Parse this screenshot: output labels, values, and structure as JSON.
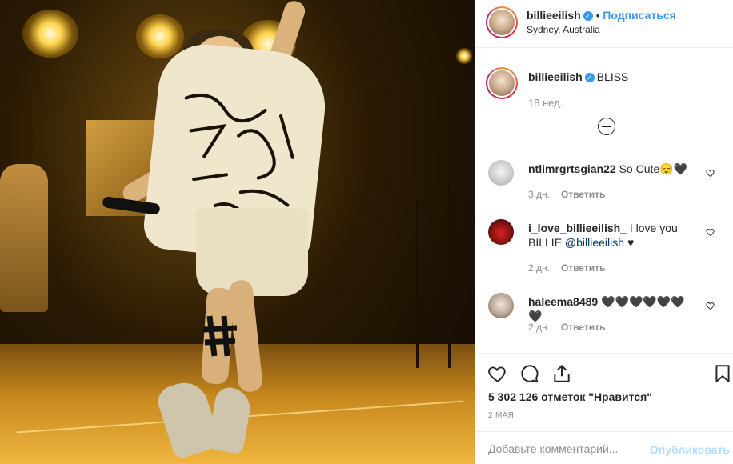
{
  "post": {
    "author": "billieeilish",
    "follow_label": "Подписаться",
    "separator": "•",
    "location": "Sydney, Australia",
    "verified_glyph": "✓"
  },
  "caption": {
    "author": "billieeilish",
    "text": "BLISS",
    "time": "18 нед."
  },
  "comments": [
    {
      "username": "ntlimrgrtsgian22",
      "text": "So Cute😌🖤",
      "time": "3 дн.",
      "reply": "Ответить"
    },
    {
      "username": "i_love_billieeilish_",
      "text_before": "I love you BILLIE ",
      "mention": "@billieeilish",
      "text_after": " ♥",
      "time": "2 дн.",
      "reply": "Ответить"
    },
    {
      "username": "haleema8489",
      "text": "🖤🖤🖤🖤🖤🖤🖤",
      "time": "2 дн.",
      "reply": "Ответить"
    }
  ],
  "actions": {
    "likes": "5 302 126 отметок \"Нравится\"",
    "date": "2 МАЯ",
    "comment_placeholder": "Добавьте комментарий...",
    "publish_label": "Опубликовать"
  },
  "colors": {
    "accent": "#3897f0",
    "publish_disabled": "#b2dffc",
    "muted": "#8e8e8e"
  }
}
